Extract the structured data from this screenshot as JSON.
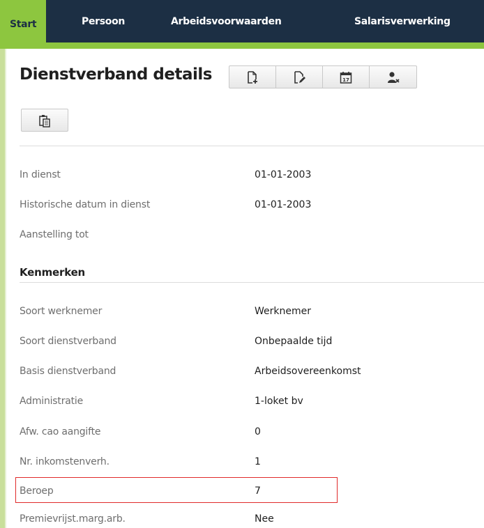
{
  "nav": {
    "tabs": [
      {
        "label": "Start"
      },
      {
        "label": "Persoon"
      },
      {
        "label": "Arbeidsvoorwaarden"
      },
      {
        "label": "Salarisverwerking"
      }
    ],
    "active_color": "#8dc63f",
    "bar_color": "#1c2f44"
  },
  "page": {
    "title": "Dienstverband details"
  },
  "toolbar": {
    "icons": [
      "new-document-icon",
      "edit-document-icon",
      "calendar-icon",
      "remove-user-icon"
    ],
    "paste_icon": "clipboard-paste-icon"
  },
  "dates": [
    {
      "label": "In dienst",
      "value": "01-01-2003"
    },
    {
      "label": "Historische datum in dienst",
      "value": "01-01-2003"
    },
    {
      "label": "Aanstelling tot",
      "value": ""
    }
  ],
  "kenmerken": {
    "heading": "Kenmerken",
    "rows": [
      {
        "label": "Soort werknemer",
        "value": "Werknemer"
      },
      {
        "label": "Soort dienstverband",
        "value": "Onbepaalde tijd"
      },
      {
        "label": "Basis dienstverband",
        "value": "Arbeidsovereenkomst"
      },
      {
        "label": "Administratie",
        "value": "1-loket bv"
      },
      {
        "label": "Afw. cao aangifte",
        "value": "0"
      },
      {
        "label": "Nr. inkomstenverh.",
        "value": "1"
      },
      {
        "label": "Beroep",
        "value": "7"
      },
      {
        "label": "Premievrijst.marg.arb.",
        "value": "Nee"
      }
    ]
  },
  "highlight_color": "#e02a2a"
}
